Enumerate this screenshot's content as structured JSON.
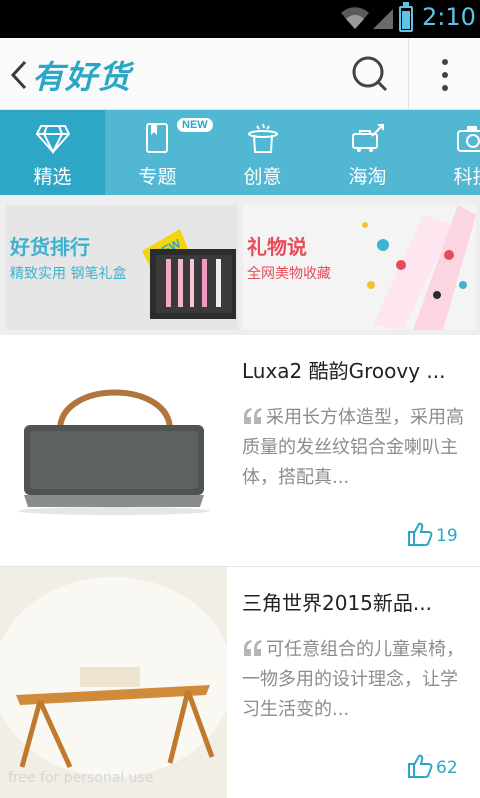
{
  "status_bar": {
    "time": "2:10"
  },
  "action_bar": {
    "title": "有好货"
  },
  "tabs": [
    {
      "label": "精选",
      "icon": "diamond-icon",
      "active": true
    },
    {
      "label": "专题",
      "icon": "bookmark-icon",
      "badge": "NEW"
    },
    {
      "label": "创意",
      "icon": "magic-hat-icon"
    },
    {
      "label": "海淘",
      "icon": "airplane-icon"
    },
    {
      "label": "科技",
      "icon": "camera-icon"
    }
  ],
  "banners": [
    {
      "title": "好货排行",
      "subtitle": "精致实用 钢笔礼盒",
      "badge": "NEW"
    },
    {
      "title": "礼物说",
      "subtitle": "全网美物收藏"
    }
  ],
  "feed": [
    {
      "title": "Luxa2 酷韵Groovy ...",
      "description": "采用长方体造型，采用高质量的发丝纹铝合金喇叭主体，搭配真...",
      "likes": "19"
    },
    {
      "title": "三角世界2015新品...",
      "description": "可任意组合的儿童桌椅，一物多用的设计理念，让学习生活变的...",
      "likes": "62"
    }
  ],
  "watermark": "free for personal use",
  "colors": {
    "accent": "#2ea6c6",
    "tab_bg": "#52b7d3"
  }
}
